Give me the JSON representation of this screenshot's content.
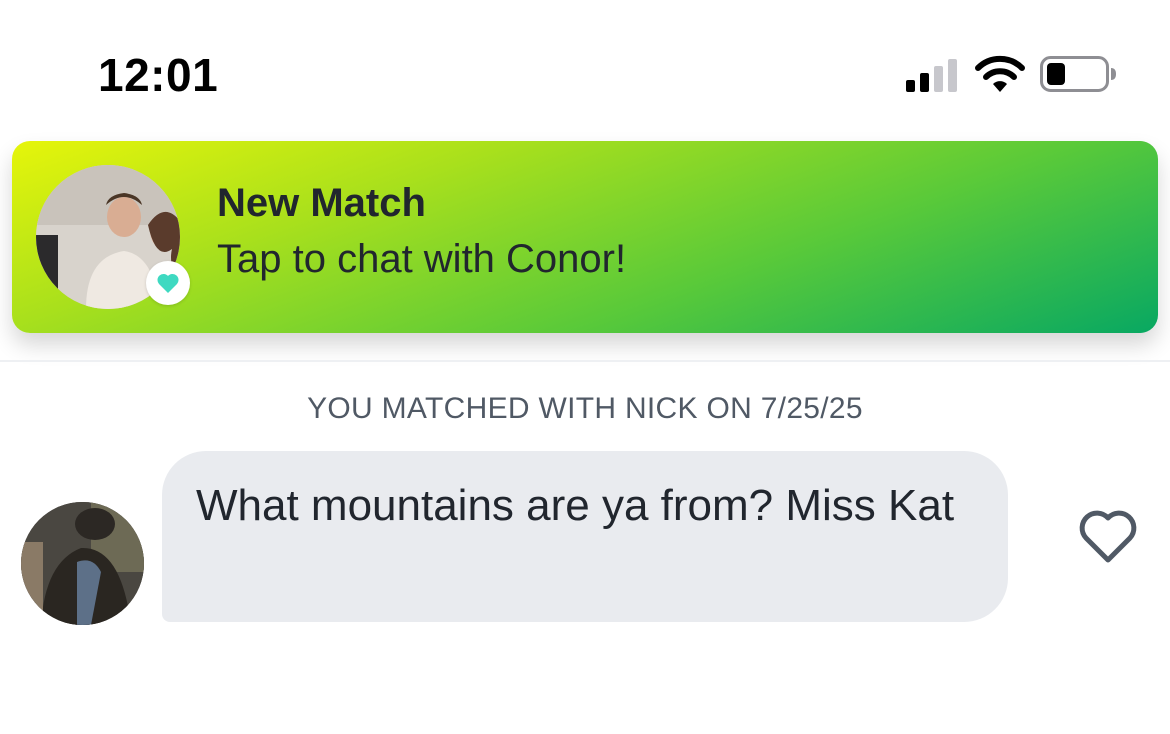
{
  "status_bar": {
    "time": "12:01",
    "signal_icon": "cellular-signal-icon",
    "wifi_icon": "wifi-icon",
    "battery_icon": "battery-icon",
    "battery_level": 0.25
  },
  "banner": {
    "title": "New Match",
    "subtitle": "Tap to chat with Conor!",
    "avatar": "match-avatar-photo",
    "badge_icon": "heart-icon",
    "badge_color": "#3ed9c1",
    "gradient_colors": [
      "#e6f50a",
      "#58c93a",
      "#08a862"
    ]
  },
  "conversation": {
    "match_date_text": "YOU MATCHED WITH NICK ON 7/25/25",
    "message": {
      "text": "What mountains are ya from?  Miss Kat",
      "sender_avatar": "sender-avatar-photo",
      "like_icon": "heart-outline-icon"
    }
  },
  "colors": {
    "bubble_bg": "#e9ebef",
    "text_primary": "#21262e",
    "text_secondary": "#505965",
    "like_icon": "#505965"
  }
}
